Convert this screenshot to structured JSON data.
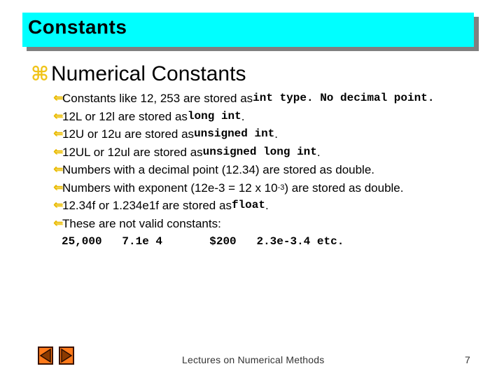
{
  "slide": {
    "title": "Constants",
    "heading_bullet_icon": "place-of-interest-bullet",
    "heading": "Numerical Constants",
    "sub_bullet_icon": "left-arrow-bullet",
    "items": [
      {
        "pre": "Constants like 12, 253 are stored as ",
        "code": "int type. No decimal point.",
        "post": ""
      },
      {
        "pre": "12L or 12l are stored as ",
        "code": "long int",
        "post": "."
      },
      {
        "pre": "12U or 12u are stored as ",
        "code": "unsigned int",
        "post": "."
      },
      {
        "pre": "12UL or 12ul are stored as ",
        "code": "unsigned long int",
        "post": "."
      },
      {
        "pre": "Numbers with a decimal point (12.34) are stored as double.",
        "code": "",
        "post": ""
      },
      {
        "pre": "Numbers with exponent (12e-3 = 12 x 10",
        "sup": "-3",
        "post": " ) are stored as double."
      },
      {
        "pre": "12.34f or 1.234e1f are stored as ",
        "code": "float",
        "post": "."
      },
      {
        "pre": "These are not valid constants:",
        "code": "",
        "post": ""
      }
    ],
    "invalid_constants": [
      "25,000",
      "7.1e 4",
      "$200",
      "2.3e-3.4",
      "etc."
    ]
  },
  "footer": {
    "text": "Lectures on Numerical Methods",
    "page_number": "7",
    "prev_button": "previous-slide",
    "next_button": "next-slide"
  },
  "colors": {
    "title_bg": "#00ffff",
    "title_shadow": "#808080",
    "bullet": "#f0c419",
    "nav_fill": "#ff7a1a",
    "nav_triangle": "#8b3a00"
  }
}
